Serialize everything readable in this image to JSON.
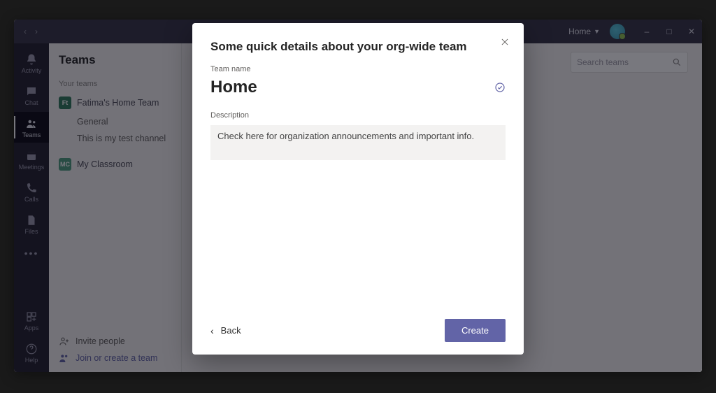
{
  "titlebar": {
    "org_name": "Home"
  },
  "rail": {
    "items": [
      {
        "label": "Activity"
      },
      {
        "label": "Chat"
      },
      {
        "label": "Teams"
      },
      {
        "label": "Meetings"
      },
      {
        "label": "Calls"
      },
      {
        "label": "Files"
      }
    ],
    "apps_label": "Apps",
    "help_label": "Help"
  },
  "teams_panel": {
    "header": "Teams",
    "section": "Your teams",
    "teams": [
      {
        "badge": "Ft",
        "color": "#2f7a5c",
        "name": "Fatima's Home Team",
        "channels": [
          "General",
          "This is my test channel"
        ]
      },
      {
        "badge": "MC",
        "color": "#4f9e7f",
        "name": "My Classroom",
        "channels": []
      }
    ],
    "invite": "Invite people",
    "join": "Join or create a team"
  },
  "search": {
    "placeholder": "Search teams"
  },
  "modal": {
    "title": "Some quick details about your org-wide team",
    "team_name_label": "Team name",
    "team_name_value": "Home",
    "description_label": "Description",
    "description_value": "Check here for organization announcements and important info.",
    "back": "Back",
    "create": "Create"
  }
}
